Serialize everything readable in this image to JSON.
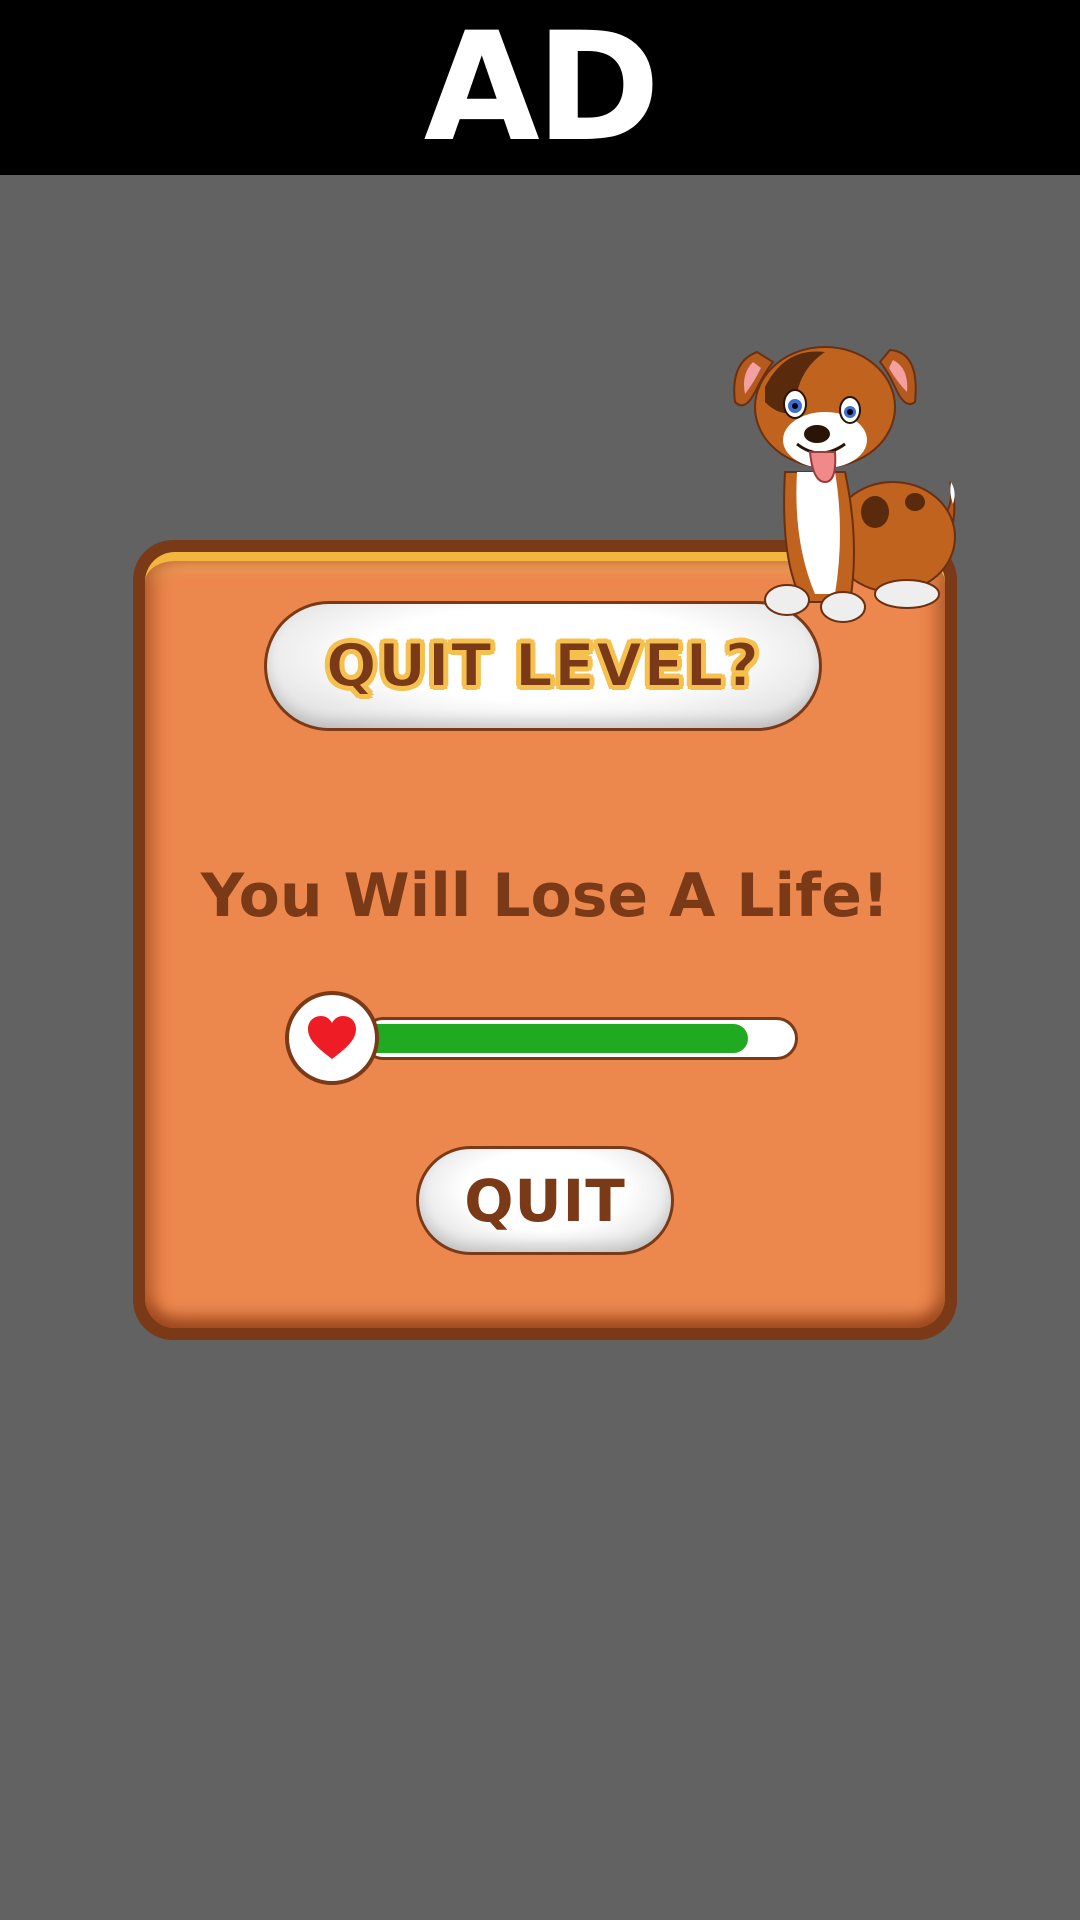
{
  "ad": {
    "label": "AD"
  },
  "dialog": {
    "title": "QUIT LEVEL?",
    "message": "You Will Lose A Life!",
    "life_progress": 0.9,
    "quit_label": "QUIT"
  },
  "colors": {
    "background": "#626262",
    "panel_fill": "#ec874e",
    "panel_border": "#7a3a17",
    "text_brown": "#7a3a17",
    "title_outline": "#f5c04e",
    "life_bar_fill": "#20aa21",
    "heart": "#ee1c25"
  },
  "icons": {
    "heart": "heart-icon",
    "mascot": "puppy-mascot"
  }
}
